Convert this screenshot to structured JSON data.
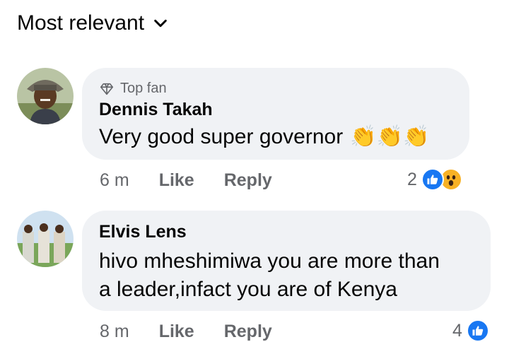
{
  "sort": {
    "label": "Most relevant"
  },
  "comments": [
    {
      "badge": "Top fan",
      "author": "Dennis Takah",
      "text": "Very good super governor",
      "emoji": "👏👏👏",
      "time": "6 m",
      "like_label": "Like",
      "reply_label": "Reply",
      "reaction_count": "2"
    },
    {
      "author": "Elvis Lens",
      "text_line1": "hivo mheshimiwa you are more than",
      "text_line2": "a leader,infact you are of Kenya",
      "time": "8 m",
      "like_label": "Like",
      "reply_label": "Reply",
      "reaction_count": "4"
    }
  ],
  "colors": {
    "like_blue": "#1877f2",
    "wow_yellow": "#f7b125",
    "bubble_bg": "#f0f2f5",
    "meta_gray": "#65676b"
  }
}
